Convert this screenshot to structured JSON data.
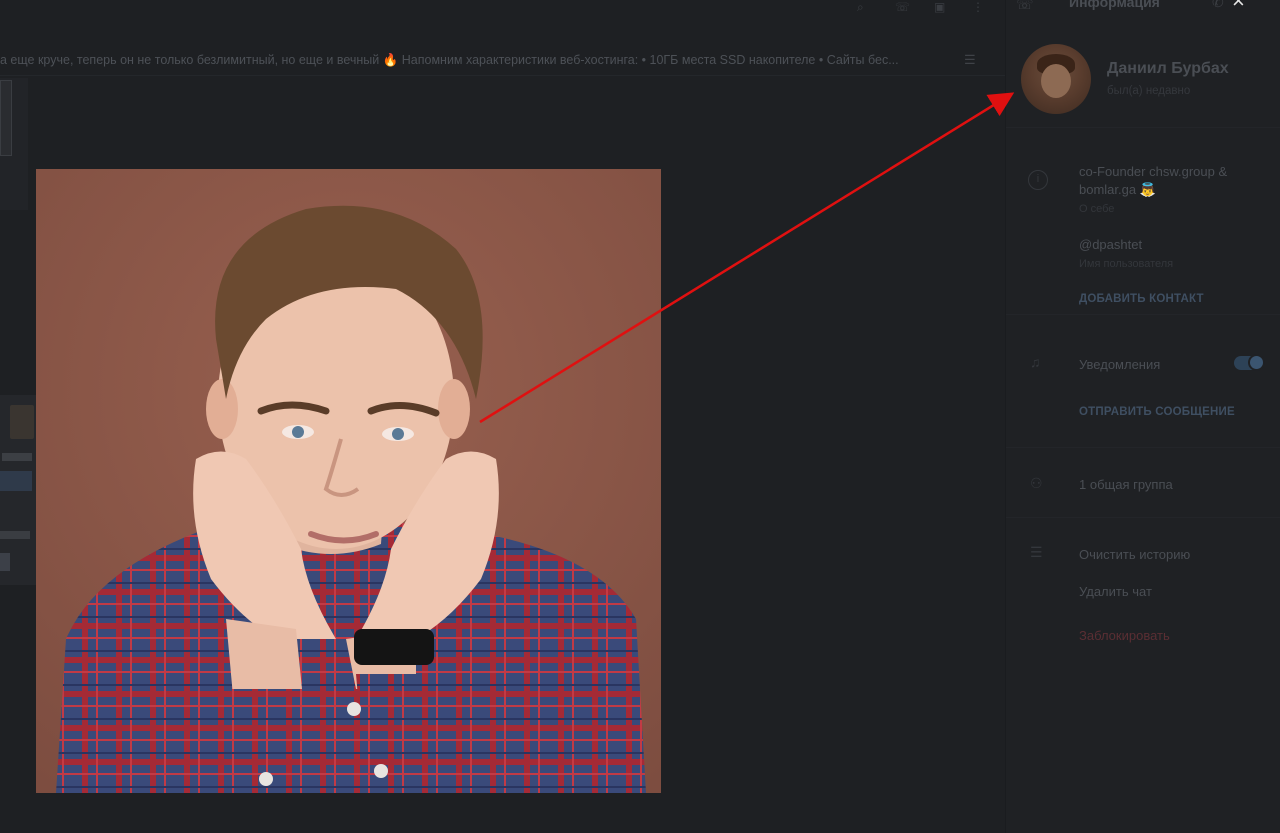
{
  "pinned": {
    "text": "а еще круче, теперь он не только безлимитный, но еще и вечный 🔥 Напомним характеристики веб-хостинга: • 10ГБ места SSD накопителе • Сайты бес..."
  },
  "panel": {
    "title": "Информация",
    "close_icon": "×",
    "profile": {
      "name": "Даниил Бурбах",
      "status": "был(а) недавно"
    },
    "info": {
      "bio": "co-Founder chsw.group & bomlar.ga 👼",
      "bio_caption": "О себе",
      "username": "@dpashtet",
      "username_caption": "Имя пользователя",
      "add_contact": "ДОБАВИТЬ КОНТАКТ"
    },
    "notifications": {
      "label": "Уведомления",
      "enabled": true,
      "send_message": "ОТПРАВИТЬ СООБЩЕНИЕ"
    },
    "groups": {
      "label": "1 общая группа"
    },
    "actions": {
      "clear_history": "Очистить историю",
      "delete_chat": "Удалить чат",
      "block": "Заблокировать"
    }
  },
  "icons": {
    "search": "search-icon",
    "close": "close-icon",
    "info": "info-icon",
    "bell": "bell-icon",
    "person": "person-icon",
    "list": "list-icon"
  },
  "colors": {
    "arrow": "#e01010",
    "photo_background": "#8a574a",
    "accent": "#3b5570"
  }
}
